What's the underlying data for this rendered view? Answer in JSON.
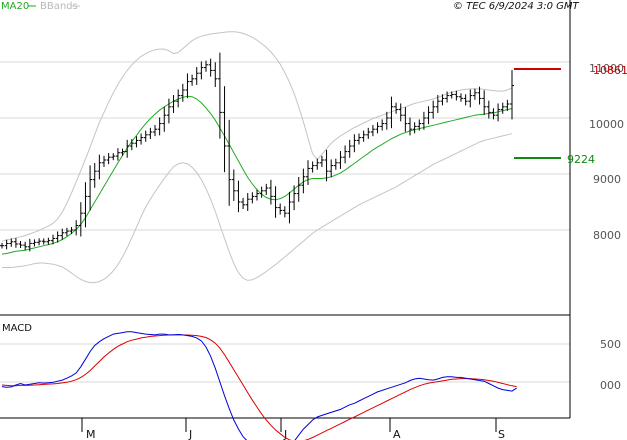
{
  "legend": {
    "ma_label": "MA20",
    "bb_label": "BBands",
    "credit": "© TEC 6/9/2024 3:0 GMT"
  },
  "colors": {
    "ma": "#22aa22",
    "bbands": "#c4c4c4",
    "price": "#000000",
    "resistance": "#cc0000",
    "support": "#118811",
    "macd": "#0000dd",
    "signal": "#dd0000",
    "grid": "#d8d8d8"
  },
  "chart_data": [
    {
      "type": "ohlc",
      "title": "",
      "x_ticks": [
        "M",
        "J",
        "J",
        "A",
        "S"
      ],
      "y_ticks": [
        "8000",
        "9000",
        "10000",
        "11000"
      ],
      "ylim": [
        7000,
        11500
      ],
      "grid": true,
      "levels": [
        {
          "name": "resistance",
          "label": "10861",
          "value": 10861
        },
        {
          "name": "support",
          "label": "9224",
          "value": 9224
        }
      ],
      "series": [
        {
          "name": "price",
          "values": [
            7720,
            7760,
            7790,
            7750,
            7730,
            7700,
            7760,
            7780,
            7800,
            7790,
            7810,
            7850,
            7900,
            7950,
            7980,
            8000,
            8080,
            8300,
            8600,
            8900,
            9050,
            9200,
            9250,
            9300,
            9320,
            9380,
            9400,
            9500,
            9550,
            9600,
            9650,
            9700,
            9750,
            9800,
            9900,
            10050,
            10200,
            10300,
            10400,
            10500,
            10650,
            10700,
            10800,
            10900,
            10950,
            10850,
            10700,
            10100,
            9500,
            8900,
            8700,
            8500,
            8450,
            8550,
            8600,
            8650,
            8700,
            8750,
            8600,
            8400,
            8350,
            8300,
            8500,
            8650,
            8800,
            8950,
            9100,
            9150,
            9200,
            9250,
            9050,
            9150,
            9200,
            9300,
            9400,
            9500,
            9600,
            9650,
            9700,
            9750,
            9800,
            9850,
            9900,
            10000,
            10200,
            10150,
            10050,
            9900,
            9800,
            9850,
            9900,
            10000,
            10100,
            10200,
            10300,
            10350,
            10400,
            10420,
            10380,
            10350,
            10300,
            10400,
            10450,
            10350,
            10200,
            10100,
            10050,
            10150,
            10200,
            10250,
            10580
          ]
        },
        {
          "name": "MA20",
          "values": [
            7570,
            7580,
            7600,
            7620,
            7630,
            7640,
            7660,
            7680,
            7700,
            7720,
            7740,
            7760,
            7790,
            7830,
            7880,
            7940,
            8010,
            8100,
            8220,
            8360,
            8500,
            8640,
            8780,
            8920,
            9060,
            9200,
            9330,
            9460,
            9580,
            9690,
            9800,
            9900,
            9990,
            10070,
            10140,
            10200,
            10250,
            10300,
            10340,
            10370,
            10390,
            10380,
            10340,
            10270,
            10180,
            10080,
            9960,
            9820,
            9680,
            9530,
            9380,
            9230,
            9080,
            8940,
            8820,
            8720,
            8640,
            8580,
            8550,
            8540,
            8560,
            8600,
            8660,
            8730,
            8800,
            8860,
            8900,
            8920,
            8920,
            8920,
            8930,
            8950,
            8980,
            9020,
            9070,
            9130,
            9190,
            9250,
            9310,
            9370,
            9430,
            9480,
            9530,
            9580,
            9630,
            9670,
            9710,
            9740,
            9770,
            9790,
            9810,
            9830,
            9850,
            9870,
            9890,
            9910,
            9930,
            9950,
            9970,
            9990,
            10010,
            10030,
            10050,
            10060,
            10070,
            10080,
            10090,
            10110,
            10130,
            10150,
            10170
          ]
        },
        {
          "name": "BBands upper",
          "values": [
            7800,
            7820,
            7840,
            7860,
            7880,
            7900,
            7930,
            7960,
            7990,
            8030,
            8070,
            8120,
            8200,
            8320,
            8480,
            8660,
            8860,
            9060,
            9270,
            9480,
            9700,
            9920,
            10100,
            10280,
            10450,
            10600,
            10730,
            10850,
            10950,
            11030,
            11100,
            11150,
            11190,
            11220,
            11230,
            11230,
            11200,
            11150,
            11170,
            11240,
            11310,
            11380,
            11430,
            11460,
            11480,
            11500,
            11510,
            11520,
            11530,
            11540,
            11540,
            11530,
            11510,
            11480,
            11440,
            11390,
            11330,
            11260,
            11180,
            11080,
            10960,
            10810,
            10640,
            10440,
            10200,
            9930,
            9640,
            9360,
            9260,
            9350,
            9450,
            9550,
            9620,
            9680,
            9730,
            9780,
            9830,
            9870,
            9910,
            9950,
            9990,
            10020,
            10050,
            10080,
            10110,
            10140,
            10170,
            10200,
            10230,
            10260,
            10280,
            10300,
            10320,
            10340,
            10370,
            10400,
            10430,
            10460,
            10480,
            10500,
            10510,
            10520,
            10520,
            10520,
            10510,
            10500,
            10490,
            10480,
            10480,
            10500,
            10540
          ]
        },
        {
          "name": "BBands lower",
          "values": [
            7330,
            7330,
            7330,
            7340,
            7350,
            7360,
            7380,
            7400,
            7410,
            7410,
            7400,
            7390,
            7370,
            7340,
            7290,
            7230,
            7170,
            7120,
            7080,
            7060,
            7060,
            7080,
            7120,
            7180,
            7270,
            7380,
            7520,
            7680,
            7860,
            8050,
            8240,
            8410,
            8550,
            8680,
            8800,
            8920,
            9030,
            9130,
            9180,
            9200,
            9180,
            9120,
            9030,
            8900,
            8740,
            8550,
            8330,
            8090,
            7850,
            7610,
            7400,
            7240,
            7140,
            7100,
            7110,
            7150,
            7200,
            7260,
            7320,
            7380,
            7450,
            7520,
            7590,
            7660,
            7730,
            7800,
            7870,
            7940,
            8000,
            8050,
            8100,
            8150,
            8200,
            8250,
            8300,
            8350,
            8400,
            8450,
            8490,
            8530,
            8570,
            8610,
            8650,
            8690,
            8730,
            8770,
            8820,
            8870,
            8920,
            8970,
            9020,
            9070,
            9120,
            9170,
            9210,
            9250,
            9290,
            9330,
            9370,
            9410,
            9450,
            9490,
            9530,
            9570,
            9600,
            9620,
            9640,
            9660,
            9680,
            9700,
            9720
          ]
        }
      ]
    },
    {
      "type": "line",
      "title": "MACD",
      "y_ticks": [
        "500",
        "000"
      ],
      "ylim": [
        -900,
        800
      ],
      "grid": true,
      "series": [
        {
          "name": "MACD",
          "values": [
            -60,
            -70,
            -65,
            -40,
            -20,
            -40,
            -30,
            -20,
            -10,
            -15,
            -10,
            -5,
            10,
            25,
            50,
            80,
            120,
            200,
            300,
            400,
            480,
            530,
            570,
            600,
            630,
            640,
            650,
            660,
            660,
            650,
            640,
            630,
            625,
            620,
            630,
            630,
            620,
            620,
            625,
            620,
            610,
            600,
            580,
            540,
            460,
            340,
            180,
            0,
            -180,
            -350,
            -500,
            -620,
            -720,
            -780,
            -800,
            -810,
            -830,
            -850,
            -860,
            -870,
            -880,
            -880,
            -850,
            -780,
            -700,
            -620,
            -560,
            -500,
            -460,
            -440,
            -420,
            -400,
            -380,
            -360,
            -330,
            -300,
            -280,
            -250,
            -220,
            -190,
            -160,
            -130,
            -110,
            -90,
            -70,
            -50,
            -30,
            -10,
            20,
            40,
            50,
            40,
            30,
            25,
            40,
            60,
            70,
            70,
            60,
            60,
            50,
            40,
            30,
            20,
            10,
            -20,
            -50,
            -80,
            -100,
            -110,
            -120,
            -80
          ]
        },
        {
          "name": "Signal",
          "values": [
            -40,
            -45,
            -50,
            -50,
            -45,
            -45,
            -42,
            -40,
            -35,
            -32,
            -28,
            -25,
            -20,
            -12,
            -2,
            10,
            30,
            60,
            100,
            150,
            210,
            270,
            330,
            380,
            430,
            470,
            500,
            530,
            550,
            565,
            580,
            590,
            600,
            605,
            610,
            615,
            618,
            620,
            622,
            620,
            618,
            615,
            610,
            600,
            585,
            555,
            510,
            445,
            360,
            260,
            160,
            60,
            -40,
            -140,
            -240,
            -330,
            -420,
            -500,
            -570,
            -630,
            -680,
            -730,
            -760,
            -780,
            -785,
            -775,
            -755,
            -730,
            -700,
            -670,
            -640,
            -610,
            -580,
            -550,
            -520,
            -490,
            -460,
            -430,
            -400,
            -370,
            -340,
            -310,
            -280,
            -250,
            -220,
            -190,
            -160,
            -130,
            -100,
            -75,
            -50,
            -30,
            -15,
            -5,
            5,
            15,
            25,
            35,
            40,
            45,
            45,
            45,
            40,
            35,
            30,
            20,
            10,
            -5,
            -20,
            -35,
            -50,
            -60
          ]
        }
      ]
    }
  ]
}
